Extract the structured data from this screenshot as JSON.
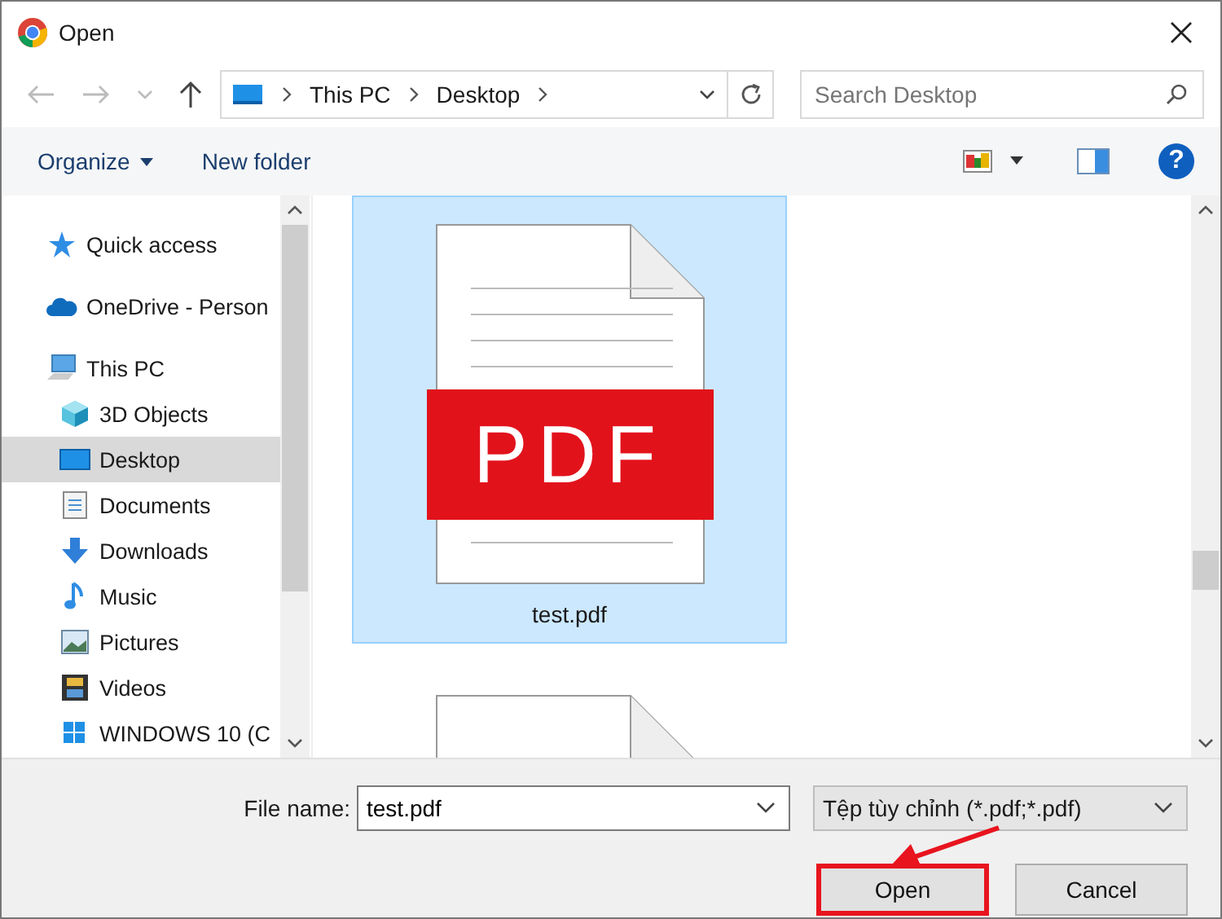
{
  "window": {
    "title": "Open"
  },
  "address_bar": {
    "path": [
      "This PC",
      "Desktop"
    ]
  },
  "search": {
    "placeholder": "Search Desktop"
  },
  "toolbar": {
    "organize": "Organize",
    "new_folder": "New folder",
    "help": "?"
  },
  "navigation": [
    {
      "label": "Quick access",
      "selected": false
    },
    {
      "label": "OneDrive - Person",
      "selected": false
    },
    {
      "label": "This PC",
      "selected": false,
      "children": [
        {
          "label": "3D Objects",
          "selected": false
        },
        {
          "label": "Desktop",
          "selected": true
        },
        {
          "label": "Documents",
          "selected": false
        },
        {
          "label": "Downloads",
          "selected": false
        },
        {
          "label": "Music",
          "selected": false
        },
        {
          "label": "Pictures",
          "selected": false
        },
        {
          "label": "Videos",
          "selected": false
        },
        {
          "label": "WINDOWS 10 (C",
          "selected": false
        }
      ]
    }
  ],
  "files": [
    {
      "name": "test.pdf",
      "badge": "PDF",
      "selected": true
    },
    {
      "selected": false
    }
  ],
  "file_name": {
    "label": "File name:",
    "value": "test.pdf"
  },
  "file_type": {
    "value": "Tệp tùy chỉnh (*.pdf;*.pdf)"
  },
  "buttons": [
    {
      "label": "Open",
      "highlighted": true
    },
    {
      "label": "Cancel",
      "highlighted": false
    }
  ]
}
